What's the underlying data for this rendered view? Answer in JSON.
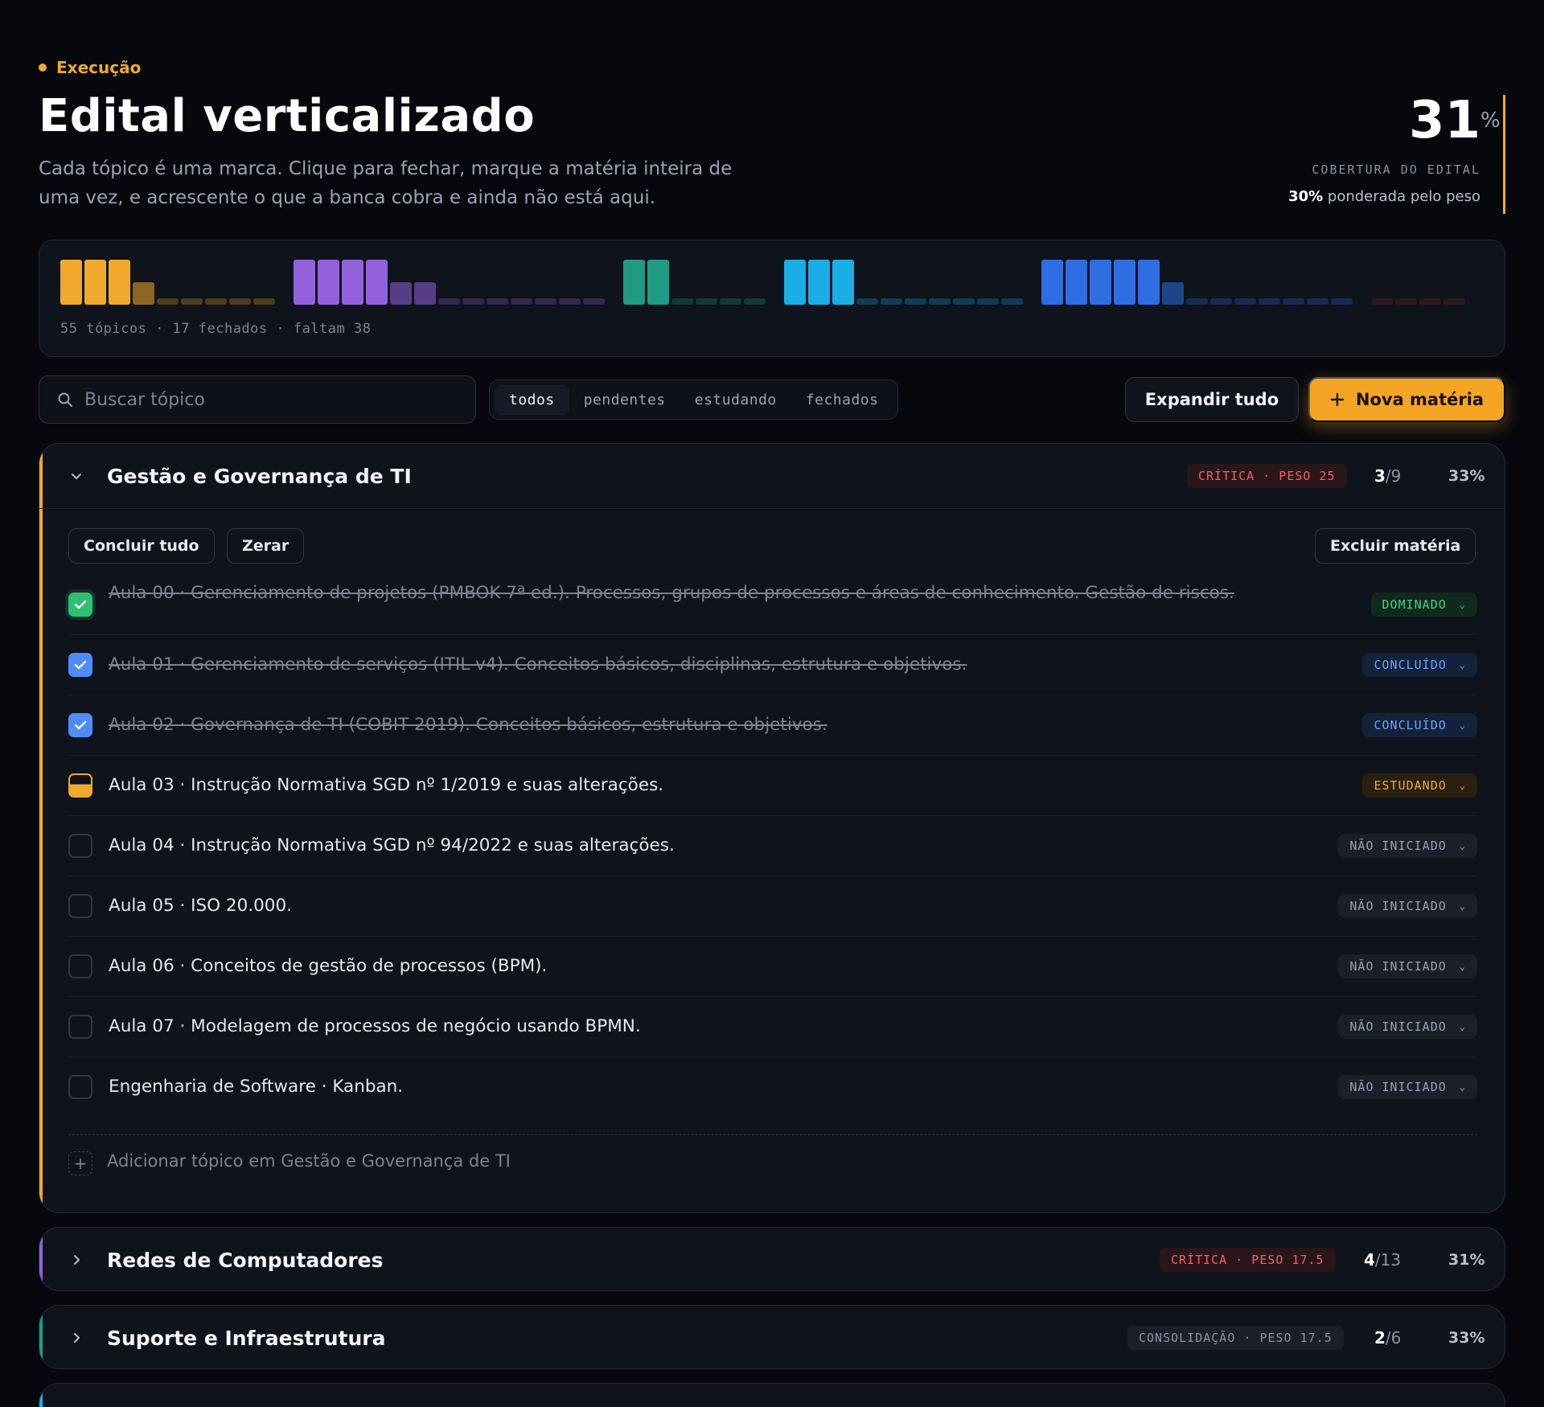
{
  "header": {
    "eyebrow": "Execução",
    "title": "Edital verticalizado",
    "subtitle": "Cada tópico é uma marca. Clique para fechar, marque a matéria inteira de uma vez, e acrescente o que a banca cobra e ainda não está aqui."
  },
  "coverage": {
    "value": "31",
    "unit": "%",
    "label": "COBERTURA DO EDITAL",
    "weighted_value": "30%",
    "weighted_text": " ponderada pelo peso"
  },
  "progress": {
    "caption": "55 tópicos · 17 fechados · faltam 38",
    "groups": [
      {
        "color": "#f0a92c",
        "done": 3,
        "studying": 1,
        "pending": 5
      },
      {
        "color": "#9461dd",
        "done": 4,
        "studying": 2,
        "pending": 7
      },
      {
        "color": "#1f9a83",
        "done": 2,
        "studying": 0,
        "pending": 4
      },
      {
        "color": "#19aee6",
        "done": 3,
        "studying": 0,
        "pending": 7
      },
      {
        "color": "#2f6de2",
        "done": 5,
        "studying": 1,
        "pending": 7
      },
      {
        "color": "#7a2430",
        "done": 0,
        "studying": 0,
        "pending": 4
      }
    ]
  },
  "search": {
    "placeholder": "Buscar tópico"
  },
  "filters": [
    "todos",
    "pendentes",
    "estudando",
    "fechados"
  ],
  "actions": {
    "expand": "Expandir tudo",
    "new_subject": "Nova matéria"
  },
  "subjects": [
    {
      "title": "Gestão e Governança de TI",
      "badge": "CRÍTICA · PESO 25",
      "done": "3",
      "total": "/9",
      "pct": "33%",
      "accent": "#f0a92c",
      "buttons": {
        "conclude": "Concluir tudo",
        "reset": "Zerar",
        "delete": "Excluir matéria"
      },
      "topics": [
        {
          "text": "Aula 00 · Gerenciamento de projetos (PMBOK 7ª ed.). Processos, grupos de processos e áreas de conhecimento. Gestão de riscos.",
          "status": "DOMINADO"
        },
        {
          "text": "Aula 01 · Gerenciamento de serviços (ITIL v4). Conceitos básicos, disciplinas, estrutura e objetivos.",
          "status": "CONCLUÍDO"
        },
        {
          "text": "Aula 02 · Governança de TI (COBIT 2019). Conceitos básicos, estrutura e objetivos.",
          "status": "CONCLUÍDO"
        },
        {
          "text": "Aula 03 · Instrução Normativa SGD nº 1/2019 e suas alterações.",
          "status": "ESTUDANDO"
        },
        {
          "text": "Aula 04 · Instrução Normativa SGD nº 94/2022 e suas alterações.",
          "status": "NÃO INICIADO"
        },
        {
          "text": "Aula 05 · ISO 20.000.",
          "status": "NÃO INICIADO"
        },
        {
          "text": "Aula 06 · Conceitos de gestão de processos (BPM).",
          "status": "NÃO INICIADO"
        },
        {
          "text": "Aula 07 · Modelagem de processos de negócio usando BPMN.",
          "status": "NÃO INICIADO"
        },
        {
          "text": "Engenharia de Software · Kanban.",
          "status": "NÃO INICIADO"
        }
      ],
      "add_label": "Adicionar tópico em Gestão e Governança de TI"
    },
    {
      "title": "Redes de Computadores",
      "badge": "CRÍTICA · PESO 17.5",
      "done": "4",
      "total": "/13",
      "pct": "31%",
      "accent": "#9461dd"
    },
    {
      "title": "Suporte e Infraestrutura",
      "badge": "CONSOLIDAÇÃO · PESO 17.5",
      "done": "2",
      "total": "/6",
      "pct": "33%",
      "accent": "#1f9a83"
    },
    {
      "accent": "#19aee6"
    }
  ]
}
